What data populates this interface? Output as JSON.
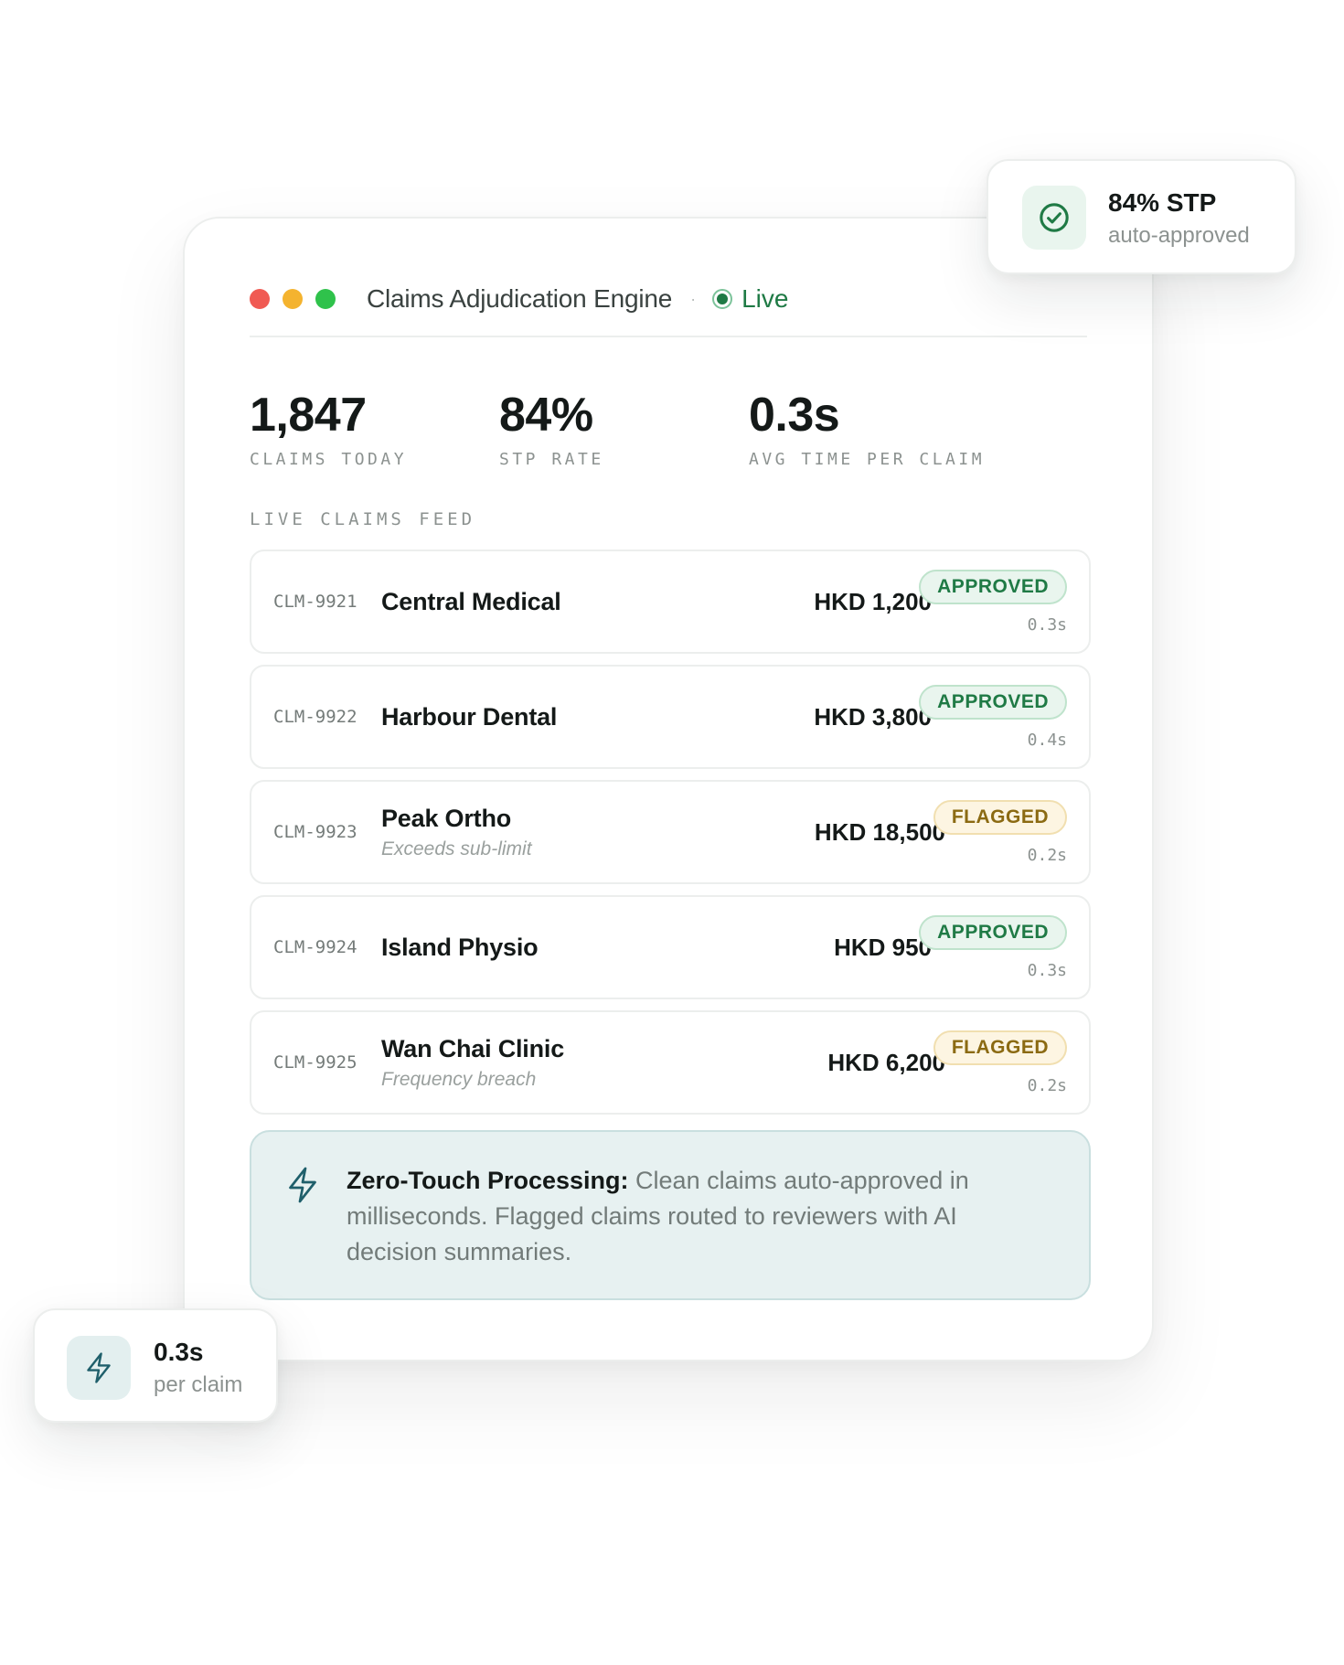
{
  "window": {
    "title": "Claims Adjudication Engine",
    "separator": "·",
    "status": "Live"
  },
  "stats": [
    {
      "value": "1,847",
      "label": "CLAIMS TODAY"
    },
    {
      "value": "84%",
      "label": "STP RATE"
    },
    {
      "value": "0.3s",
      "label": "AVG TIME PER CLAIM"
    }
  ],
  "feed": {
    "label": "LIVE CLAIMS FEED",
    "claims": [
      {
        "id": "CLM-9921",
        "name": "Central Medical",
        "note": "",
        "amount": "HKD 1,200",
        "status": "APPROVED",
        "time": "0.3s"
      },
      {
        "id": "CLM-9922",
        "name": "Harbour Dental",
        "note": "",
        "amount": "HKD 3,800",
        "status": "APPROVED",
        "time": "0.4s"
      },
      {
        "id": "CLM-9923",
        "name": "Peak Ortho",
        "note": "Exceeds sub-limit",
        "amount": "HKD 18,500",
        "status": "FLAGGED",
        "time": "0.2s"
      },
      {
        "id": "CLM-9924",
        "name": "Island Physio",
        "note": "",
        "amount": "HKD 950",
        "status": "APPROVED",
        "time": "0.3s"
      },
      {
        "id": "CLM-9925",
        "name": "Wan Chai Clinic",
        "note": "Frequency breach",
        "amount": "HKD 6,200",
        "status": "FLAGGED",
        "time": "0.2s"
      }
    ]
  },
  "info": {
    "heading": "Zero-Touch Processing:",
    "body": " Clean claims auto-approved in milliseconds. Flagged claims routed to reviewers with AI decision summaries.",
    "icon": "lightning-icon"
  },
  "float_stp": {
    "main": "84% STP",
    "sub": "auto-approved",
    "icon": "check-circle-icon"
  },
  "float_time": {
    "main": "0.3s",
    "sub": "per claim",
    "icon": "lightning-icon"
  },
  "colors": {
    "approved": "#1f7a45",
    "flagged": "#8b6a12",
    "accent_teal": "#1f5f6b",
    "traffic_red": "#f05a53",
    "traffic_yellow": "#f4b32f",
    "traffic_green": "#2fc24b"
  }
}
